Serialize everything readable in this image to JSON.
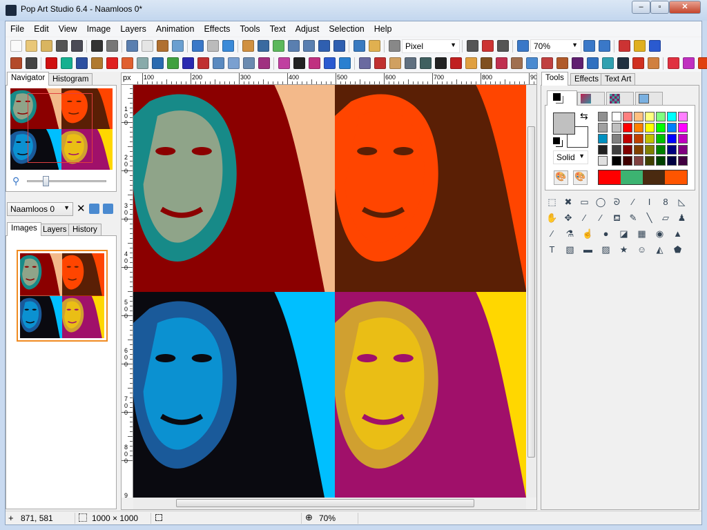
{
  "window": {
    "title": "Pop Art Studio 6.4 - Naamloos 0*",
    "minimize": "‒",
    "maximize": "▫",
    "close": "✕"
  },
  "menu": [
    "File",
    "Edit",
    "View",
    "Image",
    "Layers",
    "Animation",
    "Effects",
    "Tools",
    "Text",
    "Adjust",
    "Selection",
    "Help"
  ],
  "toolbar1": {
    "unit_select": "Pixel",
    "zoom_select": "70%",
    "icons_a": [
      [
        "new-file-icon",
        "#fafafa"
      ],
      [
        "open-folder-icon",
        "#e9c778"
      ],
      [
        "open-recent-icon",
        "#d9b560"
      ],
      [
        "webcam-icon",
        "#555"
      ],
      [
        "video-icon",
        "#4a4a55"
      ],
      "sep",
      [
        "save-icon",
        "#333"
      ],
      [
        "print-icon",
        "#777"
      ],
      "sep",
      [
        "cut-icon",
        "#5a7fb0"
      ],
      [
        "copy-icon",
        "#e5e5e5"
      ],
      [
        "paste-icon",
        "#b07030"
      ],
      [
        "paste-new-image-icon",
        "#6a9fd0"
      ],
      "sep",
      [
        "undo-icon",
        "#3a78c8"
      ],
      [
        "redo-icon",
        "#bbb"
      ],
      [
        "refresh-icon",
        "#3a8ad8"
      ],
      "sep",
      [
        "crop-icon",
        "#d09040"
      ],
      [
        "fit-icon",
        "#3a6aa0"
      ],
      [
        "add-page-icon",
        "#5cb85c"
      ],
      [
        "flip-horizontal-icon",
        "#5a7fb0"
      ],
      [
        "flip-vertical-icon",
        "#5a7fb0"
      ],
      [
        "arrange-front-icon",
        "#2f5fb0"
      ],
      [
        "arrange-back-icon",
        "#2f5fb0"
      ],
      "sep",
      [
        "settings-icon",
        "#3a7ac0"
      ],
      [
        "browse-icon",
        "#e0b050"
      ],
      "sep",
      [
        "ruler-icon",
        "#888"
      ]
    ],
    "icons_b": [
      [
        "grid-icon",
        "#555"
      ],
      [
        "grid-options-icon",
        "#c33"
      ],
      [
        "grid-settings-icon",
        "#555"
      ],
      "sep",
      [
        "zoom-out-icon",
        "#3a78c8"
      ]
    ],
    "icons_c": [
      [
        "zoom-in-icon",
        "#3a78c8"
      ],
      [
        "zoom-fit-icon",
        "#3a78c8"
      ],
      "sep",
      [
        "language-flag-icon",
        "#c33"
      ],
      [
        "help-hint-icon",
        "#e0b020"
      ],
      [
        "help-icon",
        "#2a5ad0"
      ]
    ]
  },
  "toolbar2": {
    "icons": [
      [
        "brick-effect-icon",
        "#b34a2a"
      ],
      [
        "lines-effect-icon",
        "#444"
      ],
      "sep",
      [
        "dots-effect-icon",
        "#d01010"
      ],
      [
        "glow-effect-icon",
        "#15b090"
      ],
      [
        "flag-effect-icon",
        "#2c4fa0"
      ],
      [
        "frame-effect-icon",
        "#b07a30"
      ],
      [
        "mondrian-effect-icon",
        "#e02020"
      ],
      [
        "diamond-effect-icon",
        "#e06030"
      ],
      [
        "sphere-effect-icon",
        "#8aa"
      ],
      [
        "tiles-effect-icon",
        "#2a6ab0"
      ],
      [
        "puzzle-effect-icon",
        "#40a040"
      ],
      [
        "maze-effect-icon",
        "#2a2ab0"
      ],
      [
        "spiral-effect-icon",
        "#c03030"
      ],
      [
        "picture-effect-icon",
        "#5a8ac0"
      ],
      [
        "stack-effect-icon",
        "#7aa0d0"
      ],
      [
        "network-effect-icon",
        "#6a8ab0"
      ],
      [
        "pixel-grid-effect-icon",
        "#a03080"
      ],
      "sep",
      [
        "halftone-effect-icon",
        "#c040a0"
      ],
      [
        "dice-effect-1-icon",
        "#222"
      ],
      [
        "dice-effect-2-icon",
        "#c03080"
      ],
      [
        "dice-effect-3-icon",
        "#2a5ad0"
      ],
      [
        "dice-effect-4-icon",
        "#2a80d0"
      ],
      "sep",
      [
        "square-frame-icon",
        "#6a6aa0"
      ],
      [
        "pop-portrait-1-icon",
        "#c03030"
      ],
      [
        "pop-portrait-2-icon",
        "#d0a060"
      ],
      [
        "pop-portrait-3-icon",
        "#607080"
      ],
      [
        "pop-portrait-4-icon",
        "#406060"
      ],
      [
        "pop-portrait-5-icon",
        "#222"
      ],
      [
        "che-portrait-icon",
        "#c02020"
      ],
      [
        "warhol-portrait-icon",
        "#e0a040"
      ],
      [
        "portrait-6-icon",
        "#805020"
      ],
      [
        "portrait-7-icon",
        "#c03050"
      ],
      [
        "portrait-8-icon",
        "#a07050"
      ],
      [
        "portrait-9-icon",
        "#4a8ad0"
      ],
      [
        "portrait-10-icon",
        "#c04040"
      ],
      [
        "portrait-11-icon",
        "#b05a2a"
      ],
      [
        "portrait-12-icon",
        "#602070"
      ],
      [
        "portrait-13-icon",
        "#3070c0"
      ],
      [
        "portrait-14-icon",
        "#30a0b0"
      ],
      [
        "portrait-15-icon",
        "#203040"
      ],
      [
        "portrait-16-icon",
        "#d03020"
      ],
      [
        "portrait-17-icon",
        "#d08040"
      ],
      "sep",
      [
        "portrait-18-icon",
        "#e03040"
      ],
      [
        "portrait-19-icon",
        "#c030c0"
      ],
      [
        "portrait-20-icon",
        "#e04010"
      ]
    ]
  },
  "left": {
    "tabs": [
      "Navigator",
      "Histogram"
    ],
    "layer_select": "Naamloos 0",
    "panel_tabs": [
      "Images",
      "Layers",
      "History"
    ],
    "zoom_slider_percent": 30
  },
  "rulers": {
    "unit": "px",
    "h_labels": [
      "100",
      "200",
      "300",
      "400",
      "500",
      "600",
      "700",
      "800",
      "900"
    ],
    "v_labels": [
      "100",
      "200",
      "300",
      "400",
      "500",
      "600",
      "700",
      "800",
      "900"
    ]
  },
  "canvas": {
    "quadrants": [
      {
        "bg": "#f3b98a",
        "hair": "#8b0000",
        "skin": "#178a88"
      },
      {
        "bg": "#ff4500",
        "hair": "#5a1f05",
        "skin": "#ff4500"
      },
      {
        "bg": "#00bfff",
        "hair": "#0a0a10",
        "skin": "#1a5a9a"
      },
      {
        "bg": "#ffd700",
        "hair": "#a0106a",
        "skin": "#d0a030"
      }
    ]
  },
  "right": {
    "tabs": [
      "Tools",
      "Effects",
      "Text Art"
    ],
    "fill_style": "Solid",
    "gray_column": [
      "#909090",
      "#a0a0a0",
      "#0090c0",
      "#202020",
      "#e0e0e0"
    ],
    "palette": [
      [
        "#ffffff",
        "#ff8080",
        "#ffc080",
        "#ffff80",
        "#80ff80",
        "#00ffff",
        "#ff80ff"
      ],
      [
        "#c0c0c0",
        "#ff0000",
        "#ff8000",
        "#ffff00",
        "#00ff00",
        "#0080ff",
        "#ff00ff"
      ],
      [
        "#808080",
        "#c00000",
        "#c04000",
        "#c0c000",
        "#00c000",
        "#0000ff",
        "#c000c0"
      ],
      [
        "#404040",
        "#800000",
        "#804000",
        "#808000",
        "#008000",
        "#000080",
        "#800080"
      ],
      [
        "#000000",
        "#400000",
        "#804040",
        "#404000",
        "#004000",
        "#000040",
        "#400040"
      ]
    ],
    "recent_colors": [
      "#ff0000",
      "#3cb371",
      "#4a2a10",
      "#ff5500"
    ],
    "primary_color": "#c0c0c0",
    "secondary_color": "#ffffff",
    "tools": [
      [
        "T",
        "rect-select-icon",
        "⬚"
      ],
      [
        "T",
        "deselect-icon",
        "✖"
      ],
      [
        "T",
        "rect-marquee-icon",
        "▭"
      ],
      [
        "T",
        "ellipse-select-icon",
        "◯"
      ],
      [
        "T",
        "lasso-icon",
        "ᘐ"
      ],
      [
        "T",
        "magic-wand-icon",
        "⁄"
      ],
      [
        "T",
        "text-select-icon",
        "I"
      ],
      [
        "T",
        "shape-select-icon",
        "8"
      ],
      [
        "T",
        "ruler-triangle-icon",
        "◺"
      ],
      [
        "T",
        "hand-icon",
        "✋"
      ],
      [
        "T",
        "move-icon",
        "✥"
      ],
      [
        "T",
        "eyedropper-icon",
        "⁄"
      ],
      [
        "T",
        "color-picker-icon",
        "⁄"
      ],
      [
        "T",
        "paint-bucket-icon",
        "⛾"
      ],
      [
        "T",
        "pencil-icon",
        "✎"
      ],
      [
        "T",
        "line-icon",
        "╲"
      ],
      [
        "T",
        "eraser-icon",
        "▱"
      ],
      [
        "T",
        "stamp-icon",
        "♟"
      ],
      [
        "T",
        "brush-icon",
        "⁄"
      ],
      [
        "T",
        "flask-icon",
        "⚗"
      ],
      [
        "T",
        "smudge-icon",
        "☝"
      ],
      [
        "T",
        "blur-icon",
        "●"
      ],
      [
        "T",
        "color-replace-icon",
        "◪"
      ],
      [
        "T",
        "pattern-icon",
        "▦"
      ],
      [
        "T",
        "radial-icon",
        "◉"
      ],
      [
        "T",
        "shapes-3d-icon",
        "▲"
      ],
      [
        "T",
        "text-tool-icon",
        "T"
      ],
      [
        "T",
        "gradient-icon",
        "▧"
      ],
      [
        "T",
        "fill-gradient-icon",
        "▬"
      ],
      [
        "T",
        "hatch-icon",
        "▨"
      ],
      [
        "T",
        "star-brush-icon",
        "★"
      ],
      [
        "T",
        "portrait-stamp-icon",
        "☺"
      ],
      [
        "T",
        "polygon-select-icon",
        "◭"
      ],
      [
        "T",
        "pentagon-icon",
        "⬟"
      ]
    ]
  },
  "status": {
    "cursor": "871, 581",
    "size": "1000 × 1000",
    "zoom": "70%"
  }
}
